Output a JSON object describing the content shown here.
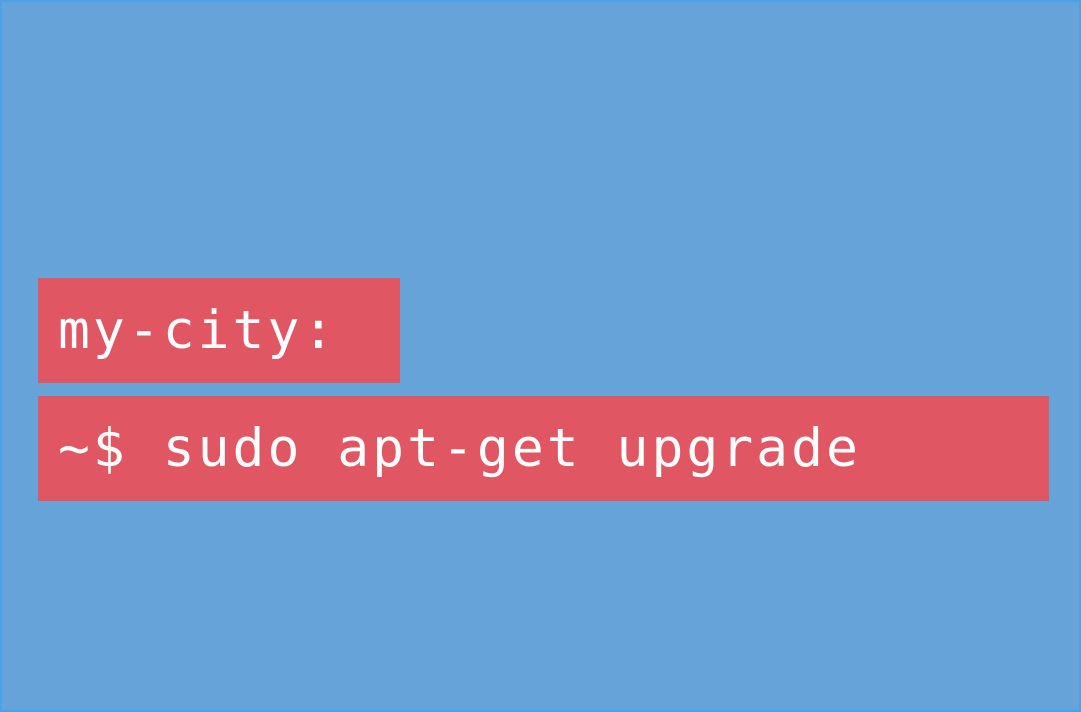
{
  "background_color": "#66a3d9",
  "border_color": "#4aa3e8",
  "highlight_color": "#e05663",
  "text_color": "#ffffff",
  "prompt": {
    "host": "my-city:",
    "command": "~$ sudo apt-get upgrade"
  }
}
